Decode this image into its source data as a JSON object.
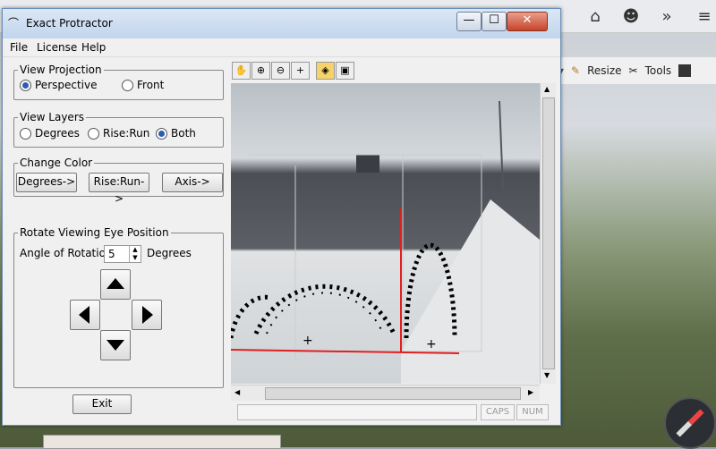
{
  "window": {
    "title": "Exact Protractor",
    "min_label": "—",
    "max_label": "☐",
    "close_label": "✕"
  },
  "menu": {
    "file": "File",
    "license": "License",
    "help": "Help"
  },
  "browser": {
    "resize": "Resize",
    "tools": "Tools"
  },
  "view_projection": {
    "legend": "View Projection",
    "options": [
      {
        "label": "Perspective",
        "selected": true
      },
      {
        "label": "Front",
        "selected": false
      }
    ]
  },
  "view_layers": {
    "legend": "View Layers",
    "options": [
      {
        "label": "Degrees",
        "selected": false
      },
      {
        "label": "Rise:Run",
        "selected": false
      },
      {
        "label": "Both",
        "selected": true
      }
    ]
  },
  "change_color": {
    "legend": "Change Color",
    "buttons": [
      "Degrees->",
      "Rise:Run->",
      "Axis->"
    ]
  },
  "rotate": {
    "legend": "Rotate Viewing Eye Position",
    "angle_label": "Angle of Rotation",
    "angle_value": "5",
    "unit": "Degrees"
  },
  "exit_label": "Exit",
  "status": {
    "caps": "CAPS",
    "num": "NUM"
  },
  "colors": {
    "accent": "#2a5db0",
    "red_axis": "#e02020"
  }
}
